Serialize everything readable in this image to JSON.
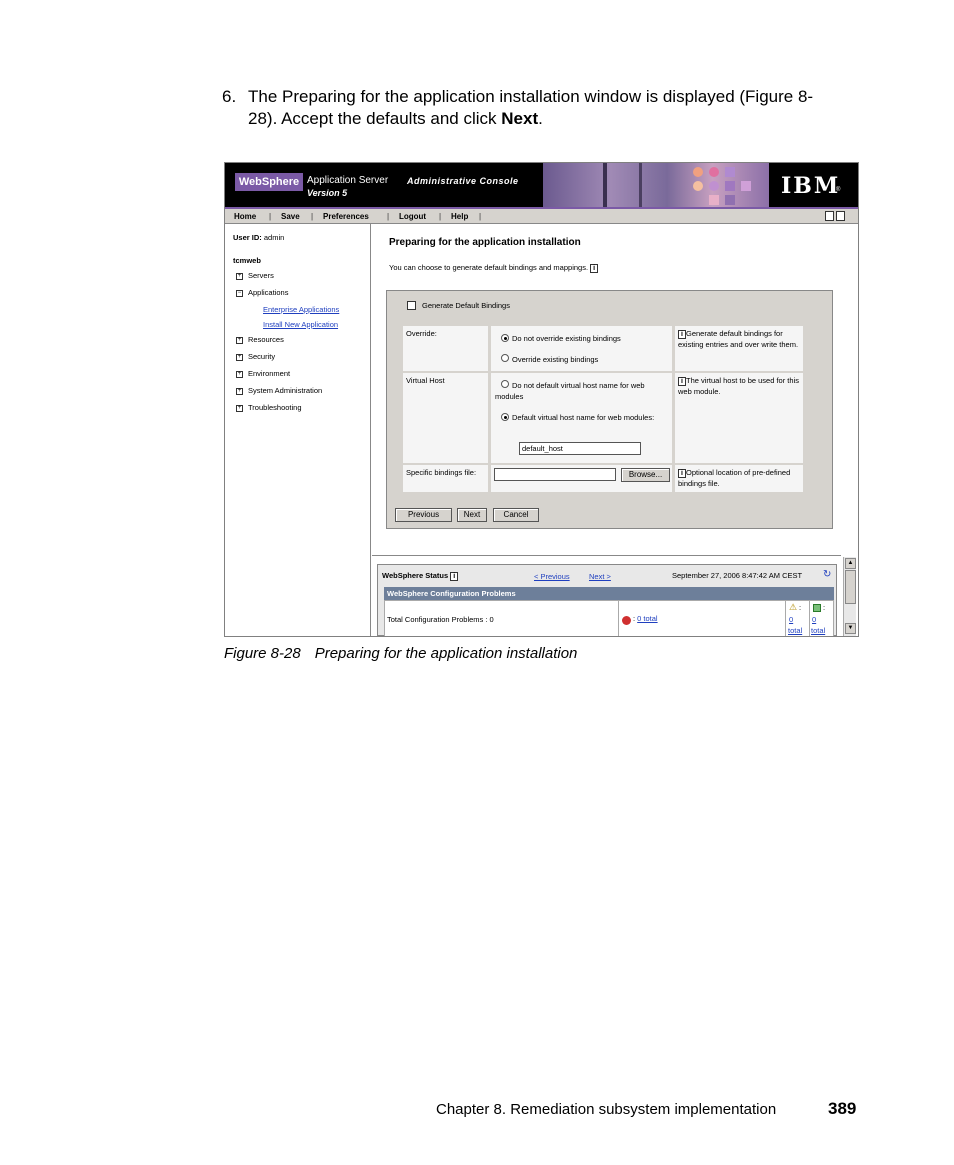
{
  "step": {
    "number": "6.",
    "text_before": "The Preparing for the application installation window is displayed (Figure 8-28). Accept the defaults and click ",
    "bold": "Next",
    "text_after": "."
  },
  "console": {
    "brand": "WebSphere",
    "product": "Application Server",
    "version": "Version 5",
    "title": "Administrative Console",
    "ibm_logo": "IBM",
    "ibm_reg": "®",
    "nav": [
      "Home",
      "Save",
      "Preferences",
      "Logout",
      "Help"
    ],
    "sidebar": {
      "user_label": "User ID:",
      "user_value": "admin",
      "node": "tcmweb",
      "items": [
        "Servers",
        "Applications",
        "Resources",
        "Security",
        "Environment",
        "System Administration",
        "Troubleshooting"
      ],
      "sub_items": [
        "Enterprise Applications",
        "Install New Application"
      ]
    },
    "main": {
      "title": "Preparing for the application installation",
      "subtitle": "You can choose to generate default bindings and mappings.",
      "generate_label": "Generate Default Bindings",
      "override_label": "Override:",
      "override_opt1": "Do not override existing bindings",
      "override_opt2": "Override existing bindings",
      "override_help": "Generate default bindings for existing entries and over write them.",
      "vhost_label": "Virtual Host",
      "vhost_opt1": "Do not default virtual host name for web modules",
      "vhost_opt2": "Default virtual host name for web modules:",
      "vhost_value": "default_host",
      "vhost_help": "The virtual host to be used for this web module.",
      "bindings_label": "Specific bindings file:",
      "browse": "Browse...",
      "bindings_help": "Optional location of pre-defined bindings file.",
      "btn_previous": "Previous",
      "btn_next": "Next",
      "btn_cancel": "Cancel"
    },
    "status": {
      "label": "WebSphere Status",
      "prev": "< Previous",
      "next": "Next >",
      "timestamp": "September 27, 2006 8:47:42 AM CEST",
      "bar_title": "WebSphere Configuration Problems",
      "problems": "Total Configuration Problems : 0",
      "error_count": "0 total",
      "warn_count_num": "0",
      "warn_count_word": "total",
      "info_count_num": "0",
      "info_count_word": "total"
    }
  },
  "caption": {
    "number": "Figure 8-28",
    "text": "Preparing for the application installation"
  },
  "footer": {
    "chapter": "Chapter 8. Remediation subsystem implementation",
    "page": "389"
  }
}
